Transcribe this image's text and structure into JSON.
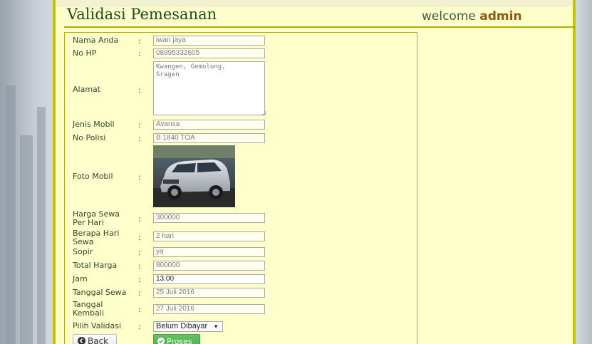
{
  "header": {
    "title": "Validasi Pemesanan",
    "welcome_prefix": "welcome",
    "welcome_user": "admin"
  },
  "form": {
    "nama": {
      "label": "Nama Anda",
      "value": "iwan jaya"
    },
    "hp": {
      "label": "No HP",
      "value": "08995332605"
    },
    "alamat": {
      "label": "Alamat",
      "value": "Kwangen, Gemolong,\nSragen"
    },
    "jenis_mobil": {
      "label": "Jenis Mobil",
      "value": "Avansa"
    },
    "no_polisi": {
      "label": "No Polisi",
      "value": "B 1840 TOA"
    },
    "foto": {
      "label": "Foto Mobil"
    },
    "harga": {
      "label": "Harga Sewa Per Hari",
      "value": "300000"
    },
    "hari": {
      "label": "Berapa Hari Sewa",
      "value": "2 hari"
    },
    "sopir": {
      "label": "Sopir",
      "value": "ya"
    },
    "total": {
      "label": "Total Harga",
      "value": "800000"
    },
    "jam": {
      "label": "Jam",
      "value": "13.00"
    },
    "tgl_sewa": {
      "label": "Tanggal Sewa",
      "value": "25 Juli 2016"
    },
    "tgl_kembali": {
      "label": "Tanggal Kembali",
      "value": "27 Juli 2016"
    },
    "validasi": {
      "label": "Pilih Validasi",
      "selected": "Belum Dibayar"
    },
    "colon": ":"
  },
  "buttons": {
    "back": "Back",
    "proses": "Proses"
  },
  "icons": {
    "back": "chevron-left-circle-icon",
    "proses": "check-circle-icon"
  },
  "colors": {
    "panel": "#ffffcc",
    "border": "#c8c300",
    "proses": "#5cb85c"
  }
}
